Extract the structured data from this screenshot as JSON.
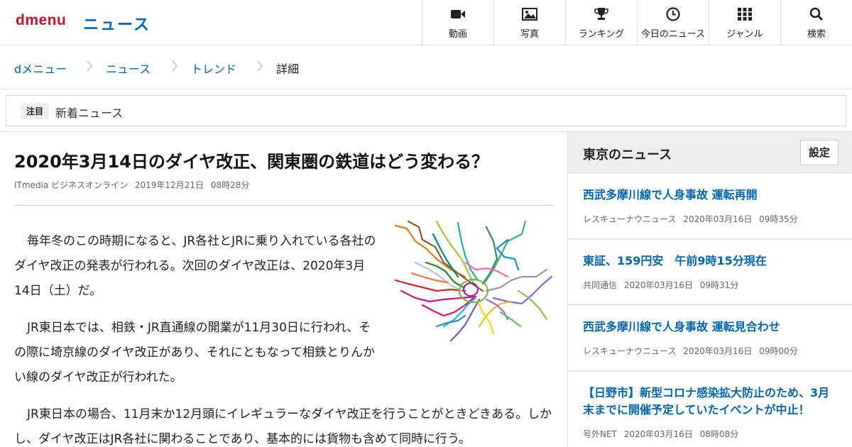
{
  "header": {
    "logo": "dmenu",
    "section_title": "ニュース",
    "nav": [
      {
        "label": "動画",
        "icon": "video-icon"
      },
      {
        "label": "写真",
        "icon": "photo-icon"
      },
      {
        "label": "ランキング",
        "icon": "trophy-icon"
      },
      {
        "label": "今日のニュース",
        "icon": "clock-icon"
      },
      {
        "label": "ジャンル",
        "icon": "grid-icon"
      },
      {
        "label": "検索",
        "icon": "search-icon"
      }
    ]
  },
  "breadcrumb": [
    "dメニュー",
    "ニュース",
    "トレンド",
    "詳細"
  ],
  "notice": {
    "badge": "注目",
    "text": "新着ニュース"
  },
  "article": {
    "title": "2020年3月14日のダイヤ改正、関東圏の鉄道はどう変わる？",
    "source": "ITmedia ビジネスオンライン",
    "date": "2019年12月21日",
    "time": "08時28分",
    "paragraphs": [
      "毎年冬のこの時期になると、JR各社とJRに乗り入れている各社のダイヤ改正の発表が行われる。次回のダイヤ改正は、2020年3月14日（土）だ。",
      "JR東日本では、相鉄・JR直通線の開業が11月30日に行われ、その際に埼京線のダイヤ改正があり、それにともなって相鉄とりんかい線のダイヤ改正が行われた。",
      "JR東日本の場合、11月末か12月頭にイレギュラーなダイヤ改正を行うことがときどきある。しかし、ダイヤ改正はJR各社に関わることであり、基本的には貨物も含めて同時に行う。"
    ],
    "figure_icon": "railway-map-illustration"
  },
  "sidebar": {
    "title": "東京のニュース",
    "settings_label": "設定",
    "items": [
      {
        "title": "西武多摩川線で人身事故 運転再開",
        "source": "レスキューナウニュース",
        "date": "2020年03月16日",
        "time": "09時35分"
      },
      {
        "title": "東証、159円安　午前9時15分現在",
        "source": "共同通信",
        "date": "2020年03月16日",
        "time": "09時31分"
      },
      {
        "title": "西武多摩川線で人身事故 運転見合わせ",
        "source": "レスキューナウニュース",
        "date": "2020年03月16日",
        "time": "09時00分"
      },
      {
        "title": "【日野市】新型コロナ感染拡大防止のため、3月末までに開催予定していたイベントが中止！",
        "source": "号外NET",
        "date": "2020年03月16日",
        "time": "08時08分"
      }
    ]
  },
  "colors": {
    "brand_red": "#c8102e",
    "link_blue": "#0066b3"
  }
}
